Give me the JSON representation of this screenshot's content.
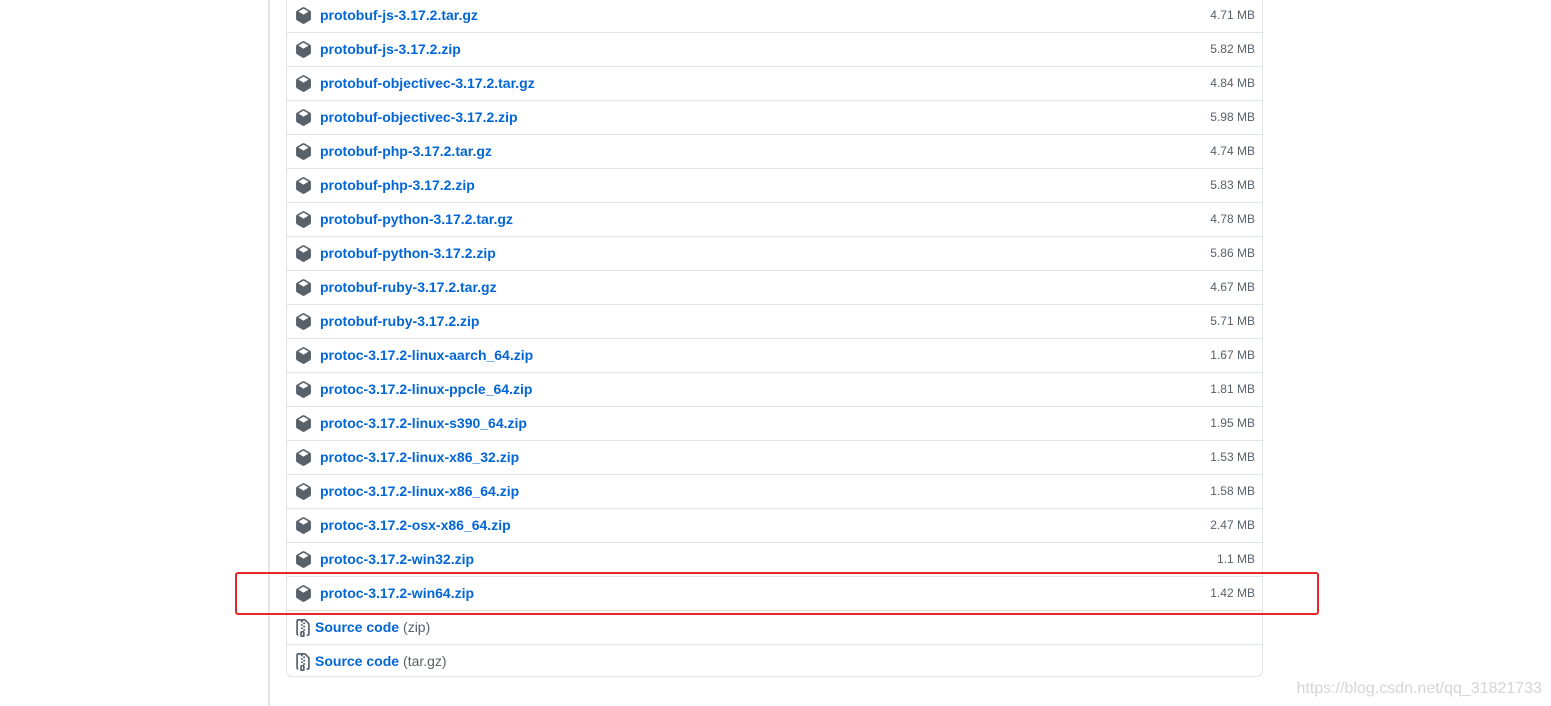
{
  "assets": [
    {
      "name": "protobuf-js-3.17.2.tar.gz",
      "size": "4.71 MB"
    },
    {
      "name": "protobuf-js-3.17.2.zip",
      "size": "5.82 MB"
    },
    {
      "name": "protobuf-objectivec-3.17.2.tar.gz",
      "size": "4.84 MB"
    },
    {
      "name": "protobuf-objectivec-3.17.2.zip",
      "size": "5.98 MB"
    },
    {
      "name": "protobuf-php-3.17.2.tar.gz",
      "size": "4.74 MB"
    },
    {
      "name": "protobuf-php-3.17.2.zip",
      "size": "5.83 MB"
    },
    {
      "name": "protobuf-python-3.17.2.tar.gz",
      "size": "4.78 MB"
    },
    {
      "name": "protobuf-python-3.17.2.zip",
      "size": "5.86 MB"
    },
    {
      "name": "protobuf-ruby-3.17.2.tar.gz",
      "size": "4.67 MB"
    },
    {
      "name": "protobuf-ruby-3.17.2.zip",
      "size": "5.71 MB"
    },
    {
      "name": "protoc-3.17.2-linux-aarch_64.zip",
      "size": "1.67 MB"
    },
    {
      "name": "protoc-3.17.2-linux-ppcle_64.zip",
      "size": "1.81 MB"
    },
    {
      "name": "protoc-3.17.2-linux-s390_64.zip",
      "size": "1.95 MB"
    },
    {
      "name": "protoc-3.17.2-linux-x86_32.zip",
      "size": "1.53 MB"
    },
    {
      "name": "protoc-3.17.2-linux-x86_64.zip",
      "size": "1.58 MB"
    },
    {
      "name": "protoc-3.17.2-osx-x86_64.zip",
      "size": "2.47 MB"
    },
    {
      "name": "protoc-3.17.2-win32.zip",
      "size": "1.1 MB"
    },
    {
      "name": "protoc-3.17.2-win64.zip",
      "size": "1.42 MB"
    }
  ],
  "source_code": [
    {
      "label": "Source code",
      "ext": "(zip)"
    },
    {
      "label": "Source code",
      "ext": "(tar.gz)"
    }
  ],
  "watermark": "https://blog.csdn.net/qq_31821733",
  "colors": {
    "link": "#0366d6",
    "muted": "#586069",
    "border": "#e1e4e8",
    "highlight": "#e8262a"
  },
  "icons": {
    "asset": "package-icon",
    "source": "file-zip-icon"
  }
}
